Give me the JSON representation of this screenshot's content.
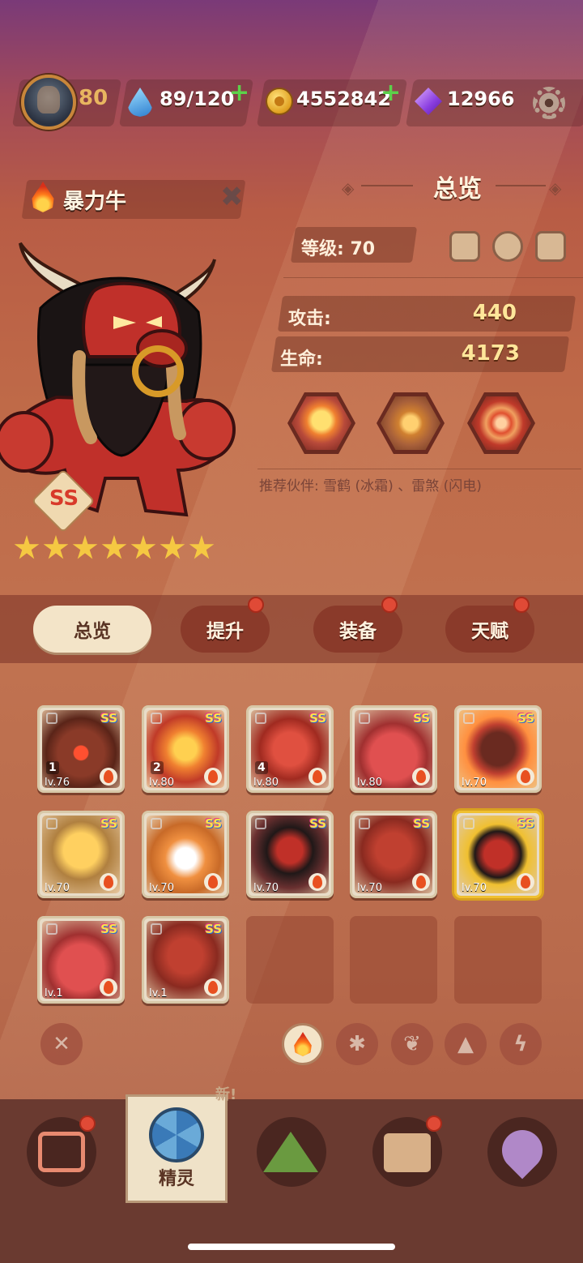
{
  "topbar": {
    "player_level": "80",
    "stamina": "89/120",
    "gold": "4552842",
    "gems": "12966"
  },
  "hero": {
    "name": "暴力牛",
    "rank": "SS",
    "stars": 7
  },
  "overview": {
    "title": "总览",
    "level_label": "等级: 70",
    "attack_label": "攻击:",
    "attack_value": "440",
    "hp_label": "生命:",
    "hp_value": "4173",
    "partners": "推荐伙伴: 雪鹤 (冰霜) 、雷煞 (闪电)"
  },
  "tabs": [
    {
      "label": "总览",
      "active": true,
      "badge": false
    },
    {
      "label": "提升",
      "active": false,
      "badge": true
    },
    {
      "label": "装备",
      "active": false,
      "badge": true
    },
    {
      "label": "天赋",
      "active": false,
      "badge": true
    }
  ],
  "cards": [
    {
      "lv": "lv.76",
      "num": "1",
      "rank": "SS",
      "art": "mech"
    },
    {
      "lv": "lv.80",
      "num": "2",
      "rank": "SS",
      "art": "fire-spirit"
    },
    {
      "lv": "lv.80",
      "num": "4",
      "rank": "SS",
      "art": "dragon"
    },
    {
      "lv": "lv.80",
      "num": "",
      "rank": "SS",
      "art": "horn-blob"
    },
    {
      "lv": "lv.70",
      "num": "",
      "rank": "SS",
      "art": "hammer"
    },
    {
      "lv": "lv.70",
      "num": "",
      "rank": "SS",
      "art": "lava-blob"
    },
    {
      "lv": "lv.70",
      "num": "",
      "rank": "SS",
      "art": "fox"
    },
    {
      "lv": "lv.70",
      "num": "",
      "rank": "SS",
      "art": "minotaur"
    },
    {
      "lv": "lv.70",
      "num": "",
      "rank": "SS",
      "art": "bear"
    },
    {
      "lv": "lv.70",
      "num": "",
      "rank": "SS",
      "art": "bull",
      "selected": true
    },
    {
      "lv": "lv.1",
      "num": "",
      "rank": "SS",
      "art": "horn-blob"
    },
    {
      "lv": "lv.1",
      "num": "",
      "rank": "SS",
      "art": "bear"
    }
  ],
  "filters": [
    "close-icon",
    "fire-icon",
    "snowflake-icon",
    "leaf-icon",
    "rock-icon",
    "lightning-icon"
  ],
  "nav": {
    "active_label": "精灵",
    "new_tag": "新!"
  },
  "colors": {
    "accent_gold": "#ffe69a",
    "badge_red": "#e04a36",
    "plus_green": "#5cd14a"
  }
}
